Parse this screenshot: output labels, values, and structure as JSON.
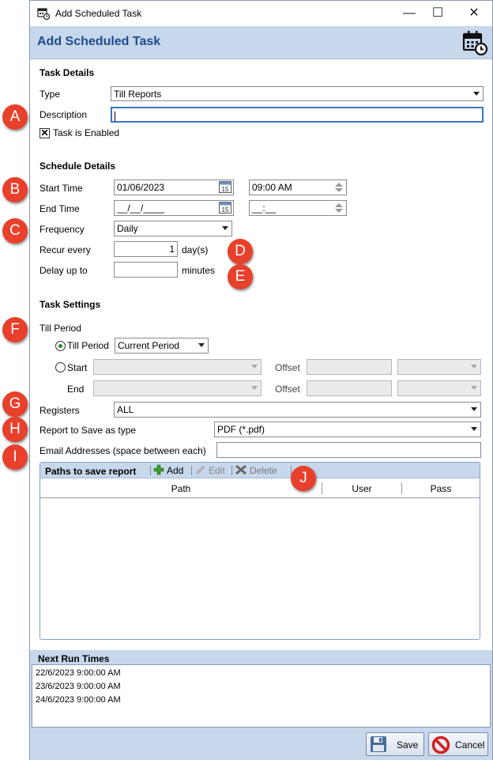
{
  "window": {
    "title": "Add Scheduled Task",
    "minimize_glyph": "—",
    "maximize_glyph": "☐",
    "close_glyph": "✕",
    "header_title": "Add Scheduled Task",
    "header_icon": "calendar-clock-icon"
  },
  "task_details": {
    "section_title": "Task Details",
    "type_label": "Type",
    "type_value": "Till Reports",
    "description_label": "Description",
    "description_value": "",
    "enabled_label": "Task is Enabled",
    "enabled_checked": true,
    "enabled_mark": "✕"
  },
  "schedule_details": {
    "section_title": "Schedule Details",
    "start_time_label": "Start Time",
    "start_date": "01/06/2023",
    "start_time": "09:00  AM",
    "end_time_label": "End Time",
    "end_date": "__/__/____",
    "end_time": "__:__",
    "frequency_label": "Frequency",
    "frequency_value": "Daily",
    "recur_label": "Recur every",
    "recur_value": "1",
    "recur_unit": "day(s)",
    "delay_label": "Delay up to",
    "delay_value": "",
    "delay_unit": "minutes"
  },
  "task_settings": {
    "section_title": "Task Settings",
    "till_period_group": "Till Period",
    "till_period_radio": "Till Period",
    "till_period_value": "Current Period",
    "start_radio": "Start",
    "end_label": "End",
    "offset_label_1": "Offset",
    "offset_label_2": "Offset",
    "registers_label": "Registers",
    "registers_value": "ALL",
    "save_type_label": "Report to Save as type",
    "save_type_value": "PDF (*.pdf)",
    "email_label": "Email Addresses (space between each)",
    "email_value": ""
  },
  "paths": {
    "title": "Paths to save report",
    "add_label": "Add",
    "edit_label": "Edit",
    "delete_label": "Delete",
    "columns": [
      "Path",
      "User",
      "Pass"
    ],
    "rows": []
  },
  "next_run": {
    "title": "Next Run Times",
    "items": [
      "22/6/2023 9:00:00 AM",
      "23/6/2023 9:00:00 AM",
      "24/6/2023 9:00:00 AM"
    ]
  },
  "footer": {
    "save_label": "Save",
    "cancel_label": "Cancel"
  },
  "callouts": [
    "A",
    "B",
    "C",
    "D",
    "E",
    "F",
    "G",
    "H",
    "I",
    "J"
  ],
  "colors": {
    "header_bg": "#c7d7ec",
    "header_title": "#1d4c8c",
    "callout": "#e8402b"
  }
}
